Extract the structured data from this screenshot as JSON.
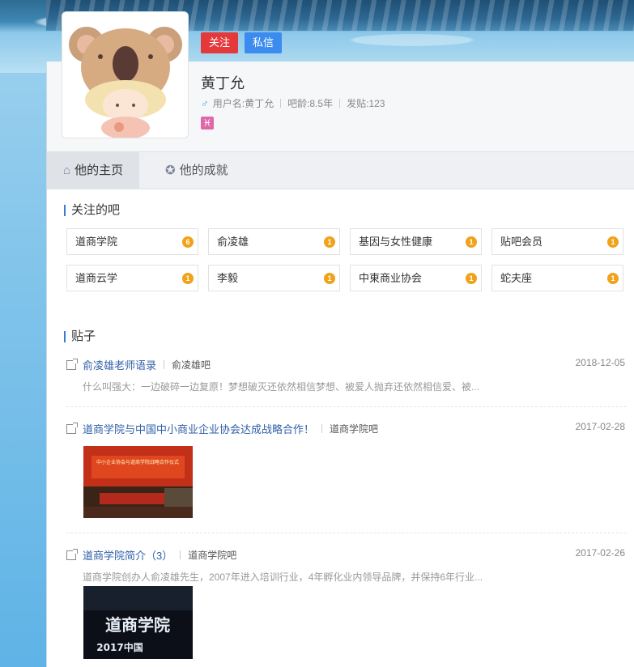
{
  "profile": {
    "follow_label": "关注",
    "message_label": "私信",
    "name": "黄丁允",
    "username_label": "用户名:黄丁允",
    "age_label": "吧龄:8.5年",
    "posts_label": "发贴:123",
    "gender_icon": "male-icon",
    "zodiac_icon": "♓"
  },
  "tabs": [
    {
      "label": "他的主页",
      "icon": "home-icon"
    },
    {
      "label": "他的成就",
      "icon": "medal-icon"
    }
  ],
  "followed_section": {
    "title": "关注的吧"
  },
  "bars": [
    {
      "name": "道商学院",
      "level": "6"
    },
    {
      "name": "俞凌雄",
      "level": "1"
    },
    {
      "name": "基因与女性健康",
      "level": "1"
    },
    {
      "name": "贴吧会员",
      "level": "1"
    },
    {
      "name": "道商云学",
      "level": "1"
    },
    {
      "name": "李毅",
      "level": "1"
    },
    {
      "name": "中東商业协会",
      "level": "1"
    },
    {
      "name": "蛇夫座",
      "level": "1"
    }
  ],
  "posts_section": {
    "title": "贴子"
  },
  "posts": [
    {
      "title": "俞凌雄老师语录",
      "forum": "俞凌雄吧",
      "date": "2018-12-05",
      "excerpt": "什么叫强大：一边破碎一边复原！梦想破灭还依然相信梦想、被爱人抛弃还依然相信爱、被..."
    },
    {
      "title": "道商学院与中国中小商业企业协会达成战略合作！",
      "forum": "道商学院吧",
      "date": "2017-02-28",
      "excerpt": ""
    },
    {
      "title": "道商学院简介（3）",
      "forum": "道商学院吧",
      "date": "2017-02-26",
      "excerpt": "道商学院创办人俞凌雄先生，2007年进入培训行业，4年孵化业内领导品牌，并保持6年行业..."
    }
  ],
  "images": {
    "photo1_title": "中小企业协会与道商学院战略合作仪式",
    "photo2_text": "道商学院",
    "photo2_sub": "2017中国"
  },
  "colors": {
    "accent": "#3c78d8",
    "follow": "#e5383b",
    "message": "#3c8cf0",
    "level": "#f0a21a"
  }
}
